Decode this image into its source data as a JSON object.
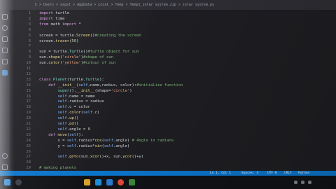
{
  "window": {
    "breadcrumb": "C > Users > asgst > AppData > Local > Temp > Temp1_solar system.zip > solar system.py"
  },
  "editor": {
    "lines": [
      {
        "n": "1",
        "parts": [
          {
            "t": "import ",
            "c": "kw"
          },
          {
            "t": "turtle",
            "c": ""
          }
        ]
      },
      {
        "n": "2",
        "parts": [
          {
            "t": "import ",
            "c": "kw"
          },
          {
            "t": "time",
            "c": ""
          }
        ]
      },
      {
        "n": "3",
        "parts": [
          {
            "t": "from ",
            "c": "kw"
          },
          {
            "t": "math ",
            "c": ""
          },
          {
            "t": "import ",
            "c": "kw"
          },
          {
            "t": "*",
            "c": ""
          }
        ]
      },
      {
        "n": "4",
        "parts": []
      },
      {
        "n": "5",
        "parts": [
          {
            "t": "screen = turtle.",
            "c": ""
          },
          {
            "t": "Screen",
            "c": "fn"
          },
          {
            "t": "()",
            "c": ""
          },
          {
            "t": "#creating the screen",
            "c": "cm"
          }
        ]
      },
      {
        "n": "6",
        "parts": [
          {
            "t": "screen.",
            "c": ""
          },
          {
            "t": "tracer",
            "c": "fn"
          },
          {
            "t": "(",
            "c": ""
          },
          {
            "t": "50",
            "c": "num"
          },
          {
            "t": ")",
            "c": ""
          }
        ]
      },
      {
        "n": "7",
        "parts": []
      },
      {
        "n": "8",
        "parts": [
          {
            "t": "sun = turtle.",
            "c": ""
          },
          {
            "t": "Turtle",
            "c": "cls"
          },
          {
            "t": "()",
            "c": ""
          },
          {
            "t": "#turtle object for sun",
            "c": "cm"
          }
        ]
      },
      {
        "n": "9",
        "parts": [
          {
            "t": "sun.",
            "c": ""
          },
          {
            "t": "shape",
            "c": "fn"
          },
          {
            "t": "(",
            "c": ""
          },
          {
            "t": "'circle'",
            "c": "str"
          },
          {
            "t": ")",
            "c": ""
          },
          {
            "t": "#shape of sun",
            "c": "cm"
          }
        ]
      },
      {
        "n": "10",
        "parts": [
          {
            "t": "sun.",
            "c": ""
          },
          {
            "t": "color",
            "c": "fn"
          },
          {
            "t": "(",
            "c": ""
          },
          {
            "t": "'yellow'",
            "c": "str"
          },
          {
            "t": ")",
            "c": ""
          },
          {
            "t": "#colour of sun",
            "c": "cm"
          }
        ]
      },
      {
        "n": "11",
        "parts": []
      },
      {
        "n": "12",
        "parts": []
      },
      {
        "n": "13",
        "parts": [
          {
            "t": "class ",
            "c": "kw"
          },
          {
            "t": "Planet",
            "c": "cls"
          },
          {
            "t": "(turtle.",
            "c": ""
          },
          {
            "t": "Turtle",
            "c": "cls"
          },
          {
            "t": "):",
            "c": ""
          }
        ]
      },
      {
        "n": "14",
        "parts": [
          {
            "t": "    def ",
            "c": "kw"
          },
          {
            "t": "__init__",
            "c": "fn"
          },
          {
            "t": "(",
            "c": ""
          },
          {
            "t": "self",
            "c": "selfc"
          },
          {
            "t": ",name,radius, color):",
            "c": ""
          },
          {
            "t": "#initialize function",
            "c": "cm"
          }
        ]
      },
      {
        "n": "15",
        "parts": [
          {
            "t": "        ",
            "c": ""
          },
          {
            "t": "super",
            "c": "cls"
          },
          {
            "t": "().",
            "c": ""
          },
          {
            "t": "__init__",
            "c": "fn"
          },
          {
            "t": "(shape=",
            "c": ""
          },
          {
            "t": "'circle'",
            "c": "str"
          },
          {
            "t": ")",
            "c": ""
          }
        ]
      },
      {
        "n": "16",
        "parts": [
          {
            "t": "        ",
            "c": ""
          },
          {
            "t": "self",
            "c": "selfc"
          },
          {
            "t": ".name = name",
            "c": ""
          }
        ]
      },
      {
        "n": "17",
        "parts": [
          {
            "t": "        ",
            "c": ""
          },
          {
            "t": "self",
            "c": "selfc"
          },
          {
            "t": ".radius = radius",
            "c": ""
          }
        ]
      },
      {
        "n": "18",
        "parts": [
          {
            "t": "        ",
            "c": ""
          },
          {
            "t": "self",
            "c": "selfc"
          },
          {
            "t": ".c = color",
            "c": ""
          }
        ]
      },
      {
        "n": "19",
        "parts": [
          {
            "t": "        ",
            "c": ""
          },
          {
            "t": "self",
            "c": "selfc"
          },
          {
            "t": ".",
            "c": ""
          },
          {
            "t": "color",
            "c": "fn"
          },
          {
            "t": "(",
            "c": ""
          },
          {
            "t": "self",
            "c": "selfc"
          },
          {
            "t": ".c)",
            "c": ""
          }
        ]
      },
      {
        "n": "20",
        "parts": [
          {
            "t": "        ",
            "c": ""
          },
          {
            "t": "self",
            "c": "selfc"
          },
          {
            "t": ".",
            "c": ""
          },
          {
            "t": "up",
            "c": "fn"
          },
          {
            "t": "()",
            "c": ""
          }
        ]
      },
      {
        "n": "21",
        "parts": [
          {
            "t": "        ",
            "c": ""
          },
          {
            "t": "self",
            "c": "selfc"
          },
          {
            "t": ".",
            "c": ""
          },
          {
            "t": "pd",
            "c": "fn"
          },
          {
            "t": "()",
            "c": ""
          }
        ]
      },
      {
        "n": "22",
        "parts": [
          {
            "t": "        ",
            "c": ""
          },
          {
            "t": "self",
            "c": "selfc"
          },
          {
            "t": ".angle = ",
            "c": ""
          },
          {
            "t": "0",
            "c": "num"
          }
        ]
      },
      {
        "n": "23",
        "parts": [
          {
            "t": "    def ",
            "c": "kw"
          },
          {
            "t": "move",
            "c": "fn"
          },
          {
            "t": "(",
            "c": ""
          },
          {
            "t": "self",
            "c": "selfc"
          },
          {
            "t": "):",
            "c": ""
          }
        ]
      },
      {
        "n": "24",
        "parts": [
          {
            "t": "        x = ",
            "c": ""
          },
          {
            "t": "self",
            "c": "selfc"
          },
          {
            "t": ".radius*",
            "c": ""
          },
          {
            "t": "cos",
            "c": "fn"
          },
          {
            "t": "(",
            "c": ""
          },
          {
            "t": "self",
            "c": "selfc"
          },
          {
            "t": ".angle) ",
            "c": ""
          },
          {
            "t": "# Angle in radians",
            "c": "cm"
          }
        ]
      },
      {
        "n": "25",
        "parts": [
          {
            "t": "        y = ",
            "c": ""
          },
          {
            "t": "self",
            "c": "selfc"
          },
          {
            "t": ".radius*",
            "c": ""
          },
          {
            "t": "sin",
            "c": "fn"
          },
          {
            "t": "(",
            "c": ""
          },
          {
            "t": "self",
            "c": "selfc"
          },
          {
            "t": ".angle)",
            "c": ""
          }
        ]
      },
      {
        "n": "26",
        "parts": []
      },
      {
        "n": "27",
        "parts": [
          {
            "t": "        ",
            "c": ""
          },
          {
            "t": "self",
            "c": "selfc"
          },
          {
            "t": ".",
            "c": ""
          },
          {
            "t": "goto",
            "c": "fn"
          },
          {
            "t": "(sun.",
            "c": ""
          },
          {
            "t": "xcor",
            "c": "fn"
          },
          {
            "t": "()+x, sun.",
            "c": ""
          },
          {
            "t": "ycor",
            "c": "fn"
          },
          {
            "t": "()+y)",
            "c": ""
          }
        ]
      },
      {
        "n": "28",
        "parts": []
      },
      {
        "n": "29",
        "parts": [
          {
            "t": "# making planets",
            "c": "cm"
          }
        ]
      }
    ]
  },
  "statusbar": {
    "position": "Ln 1, Col 1",
    "spaces": "Spaces: 4",
    "encoding": "UTF-8",
    "eol": "CRLF",
    "language": "Python"
  },
  "colors": {
    "editor_bg": "#1e1e22",
    "statusbar_bg": "#0b74c9",
    "taskbar_bg": "#101216"
  }
}
